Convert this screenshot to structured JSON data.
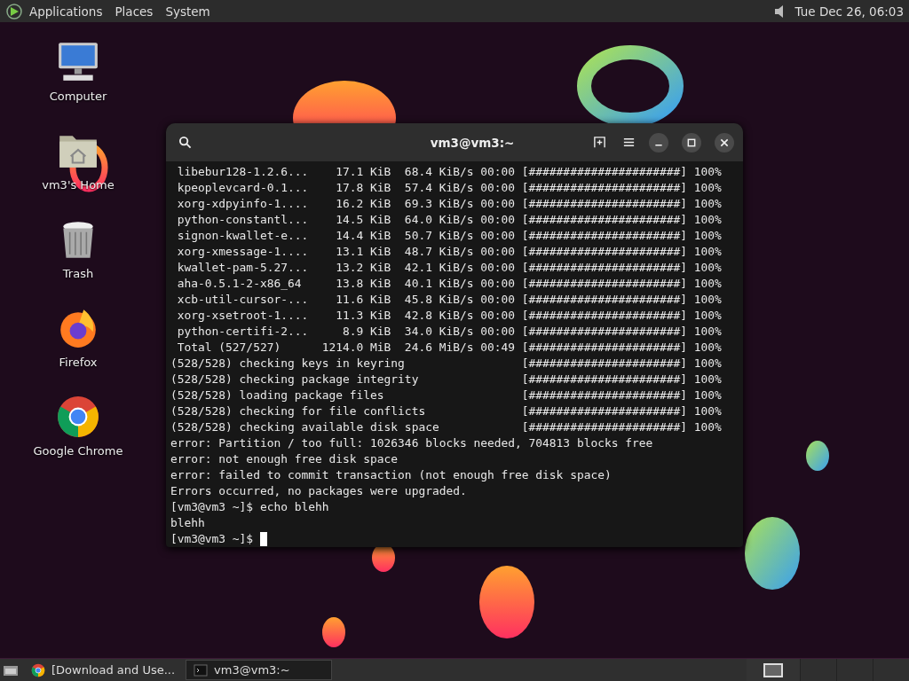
{
  "top_panel": {
    "menus": [
      "Applications",
      "Places",
      "System"
    ],
    "clock": "Tue Dec 26, 06:03"
  },
  "desktop_icons": [
    {
      "kind": "computer",
      "label": "Computer"
    },
    {
      "kind": "home",
      "label": "vm3's Home"
    },
    {
      "kind": "trash",
      "label": "Trash"
    },
    {
      "kind": "firefox",
      "label": "Firefox"
    },
    {
      "kind": "chrome",
      "label": "Google Chrome"
    }
  ],
  "terminal": {
    "title": "vm3@vm3:~",
    "lines": [
      " libebur128-1.2.6...    17.1 KiB  68.4 KiB/s 00:00 [######################] 100%",
      " kpeoplevcard-0.1...    17.8 KiB  57.4 KiB/s 00:00 [######################] 100%",
      " xorg-xdpyinfo-1....    16.2 KiB  69.3 KiB/s 00:00 [######################] 100%",
      " python-constantl...    14.5 KiB  64.0 KiB/s 00:00 [######################] 100%",
      " signon-kwallet-e...    14.4 KiB  50.7 KiB/s 00:00 [######################] 100%",
      " xorg-xmessage-1....    13.1 KiB  48.7 KiB/s 00:00 [######################] 100%",
      " kwallet-pam-5.27...    13.2 KiB  42.1 KiB/s 00:00 [######################] 100%",
      " aha-0.5.1-2-x86_64     13.8 KiB  40.1 KiB/s 00:00 [######################] 100%",
      " xcb-util-cursor-...    11.6 KiB  45.8 KiB/s 00:00 [######################] 100%",
      " xorg-xsetroot-1....    11.3 KiB  42.8 KiB/s 00:00 [######################] 100%",
      " python-certifi-2...     8.9 KiB  34.0 KiB/s 00:00 [######################] 100%",
      " Total (527/527)      1214.0 MiB  24.6 MiB/s 00:49 [######################] 100%",
      "(528/528) checking keys in keyring                 [######################] 100%",
      "(528/528) checking package integrity               [######################] 100%",
      "(528/528) loading package files                    [######################] 100%",
      "(528/528) checking for file conflicts              [######################] 100%",
      "(528/528) checking available disk space            [######################] 100%",
      "error: Partition / too full: 1026346 blocks needed, 704813 blocks free",
      "error: not enough free disk space",
      "error: failed to commit transaction (not enough free disk space)",
      "Errors occurred, no packages were upgraded.",
      "[vm3@vm3 ~]$ echo blehh",
      "blehh",
      "[vm3@vm3 ~]$ "
    ]
  },
  "taskbar": {
    "tasks": [
      {
        "kind": "chrome",
        "label": "[Download and Use...",
        "selected": false
      },
      {
        "kind": "terminal",
        "label": "vm3@vm3:~",
        "selected": true
      }
    ]
  }
}
